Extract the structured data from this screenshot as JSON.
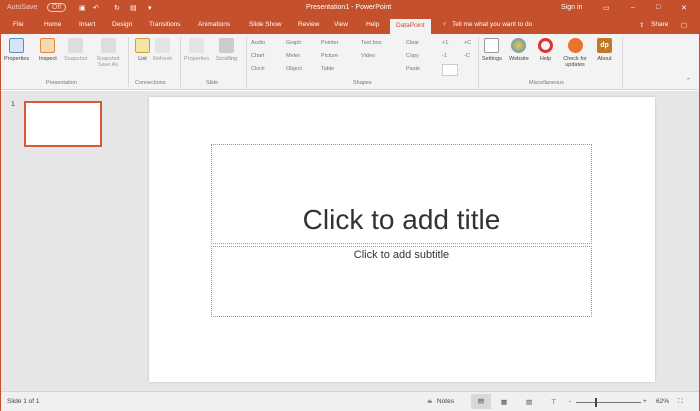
{
  "titlebar": {
    "autosave": "AutoSave",
    "autosave_state": "Off",
    "title": "Presentation1 - PowerPoint",
    "signin": "Sign in"
  },
  "tabs": [
    "File",
    "Home",
    "Insert",
    "Design",
    "Transitions",
    "Animations",
    "Slide Show",
    "Review",
    "View",
    "Help",
    "DataPoint"
  ],
  "tellme": "Tell me what you want to do",
  "share": "Share",
  "ribbon": {
    "presentation": {
      "label": "Presentation",
      "buttons": [
        "Properties",
        "Inspect",
        "Snapshot",
        "Snapshot Save As"
      ]
    },
    "connections": {
      "label": "Connections",
      "buttons": [
        "List",
        "Refresh"
      ]
    },
    "slide": {
      "label": "Slide",
      "buttons": [
        "Properties",
        "Scrolling"
      ]
    },
    "shapes": {
      "label": "Shapes",
      "items": [
        "Audio",
        "Chart",
        "Clock",
        "Graph",
        "Meter",
        "Object",
        "Pointer",
        "Picture",
        "Table",
        "Text box",
        "Video",
        "Clear",
        "Copy",
        "Paste",
        "+1",
        "-1",
        "+C",
        "-C"
      ]
    },
    "misc": {
      "label": "Miscellaneous",
      "buttons": [
        "Settings",
        "Website",
        "Help",
        "Check for updates",
        "About"
      ]
    }
  },
  "slide_number": "1",
  "slide": {
    "title": "Click to add title",
    "subtitle": "Click to add subtitle"
  },
  "status": {
    "slide_of": "Slide 1 of 1",
    "notes": "Notes",
    "zoom": "62%"
  }
}
